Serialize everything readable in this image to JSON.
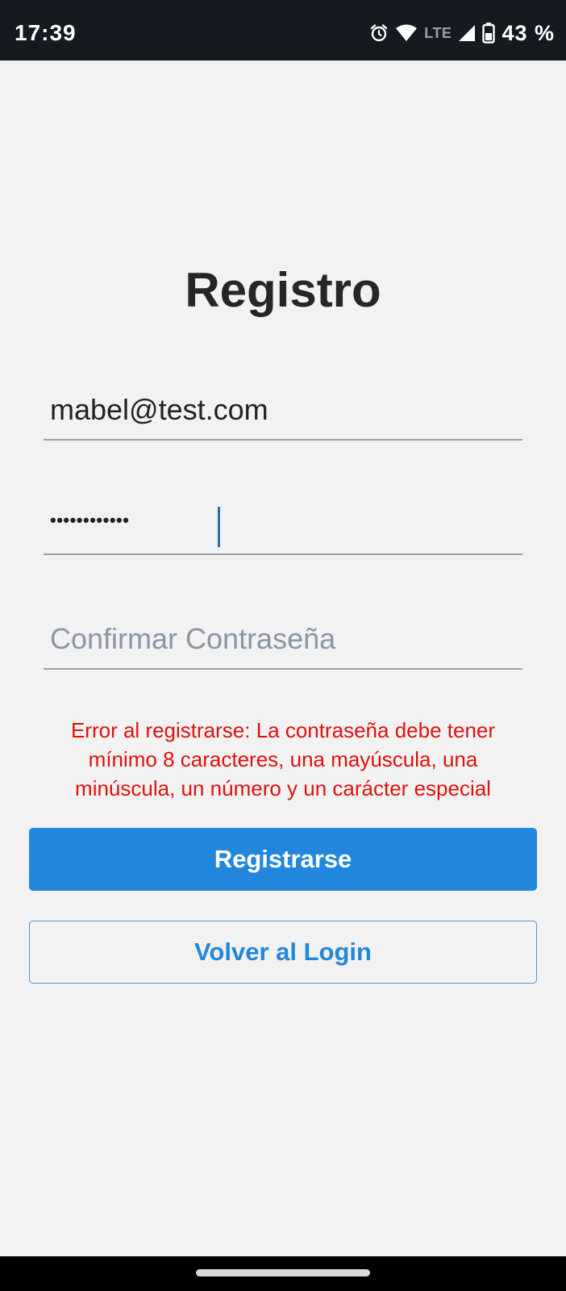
{
  "status_bar": {
    "time": "17:39",
    "network_label": "LTE",
    "battery_percent": "43 %",
    "icons": [
      "alarm-icon",
      "wifi-icon",
      "cell-signal-icon",
      "battery-icon"
    ]
  },
  "screen": {
    "title": "Registro"
  },
  "form": {
    "email_value": "mabel@test.com",
    "password_masked": "••••••••••••",
    "confirm_placeholder": "Confirmar Contraseña",
    "error_message": "Error al registrarse: La contraseña debe tener mínimo 8 caracteres, una mayúscula, una minúscula, un número y un carácter especial",
    "register_label": "Registrarse",
    "back_label": "Volver al Login"
  },
  "colors": {
    "background": "#f2f2f2",
    "status_bar": "#151a21",
    "primary": "#2287dc",
    "error": "#e01010",
    "title_text": "#262626"
  }
}
